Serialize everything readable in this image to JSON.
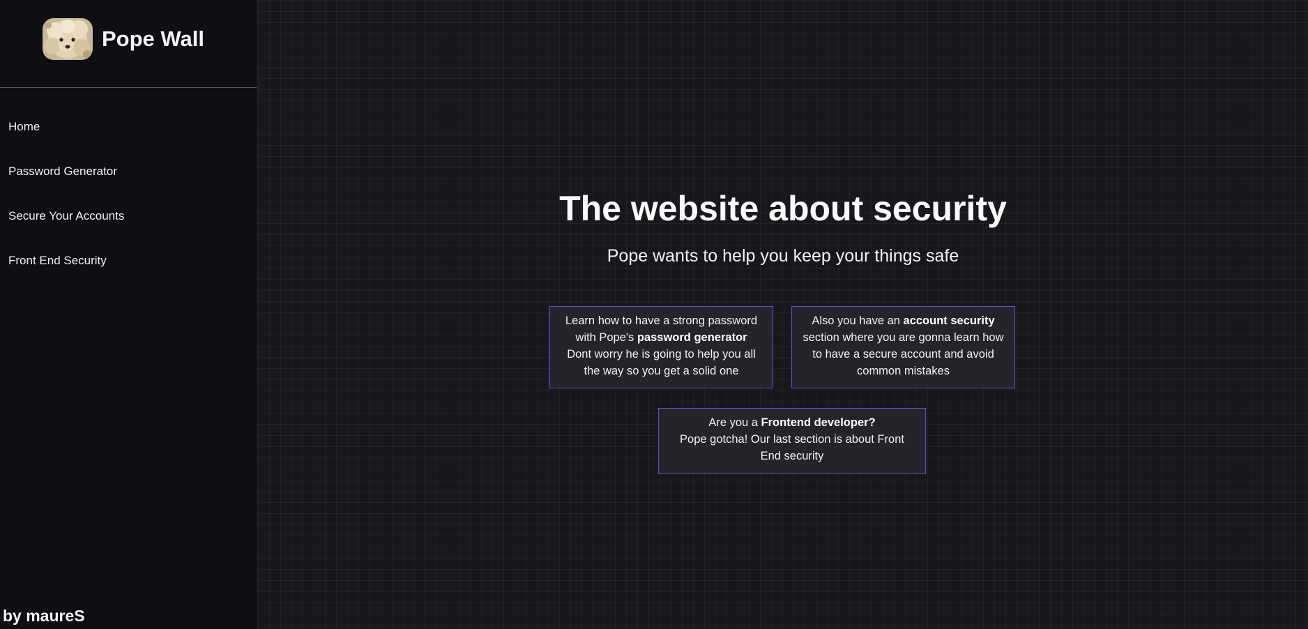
{
  "sidebar": {
    "brand": {
      "title": "Pope Wall",
      "avatar_icon": "poodle-avatar"
    },
    "nav": [
      {
        "label": "Home"
      },
      {
        "label": "Password Generator"
      },
      {
        "label": "Secure Your Accounts"
      },
      {
        "label": "Front End Security"
      }
    ],
    "credit": "by maureS"
  },
  "main": {
    "title": "The website about security",
    "subtitle": "Pope wants to help you keep your things safe",
    "cards": [
      {
        "lines": [
          {
            "text": "Learn how to have a strong password"
          },
          {
            "pre": "with Pope's ",
            "bold": "password generator"
          },
          {
            "text": "Dont worry he is going to help you all"
          },
          {
            "text": "the way so you get a solid one"
          }
        ]
      },
      {
        "lines": [
          {
            "pre": "Also you have an ",
            "bold": "account security"
          },
          {
            "text": "section where you are gonna learn how"
          },
          {
            "text": "to have a secure account and avoid"
          },
          {
            "text": "common mistakes"
          }
        ]
      },
      {
        "lines": [
          {
            "pre": "Are you a ",
            "bold": "Frontend developer?"
          },
          {
            "text": "Pope gotcha! Our last section is about Front"
          },
          {
            "text": "End security"
          }
        ]
      }
    ]
  },
  "colors": {
    "sidebar_bg": "#0e0f13",
    "main_bg": "#17181c",
    "card_bg": "#23252b",
    "card_border": "#6f45d8",
    "text": "#ffffff"
  }
}
